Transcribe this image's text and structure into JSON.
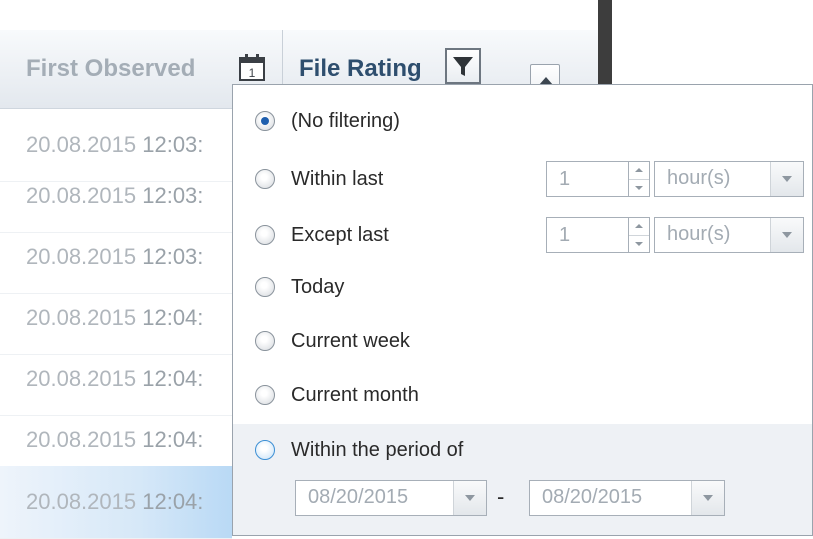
{
  "header": {
    "first_observed_label": "First Observed",
    "file_rating_label": "File Rating"
  },
  "rows": [
    {
      "date": "20.08.2015",
      "time": "12:03:"
    },
    {
      "date": "20.08.2015",
      "time": "12:03:"
    },
    {
      "date": "20.08.2015",
      "time": "12:03:"
    },
    {
      "date": "20.08.2015",
      "time": "12:04:"
    },
    {
      "date": "20.08.2015",
      "time": "12:04:"
    },
    {
      "date": "20.08.2015",
      "time": "12:04:"
    },
    {
      "date": "20.08.2015",
      "time": "12:04:"
    }
  ],
  "filter": {
    "options": [
      {
        "label": "(No filtering)",
        "checked": true
      },
      {
        "label": "Within last",
        "checked": false
      },
      {
        "label": "Except last",
        "checked": false
      },
      {
        "label": "Today",
        "checked": false
      },
      {
        "label": "Current week",
        "checked": false
      },
      {
        "label": "Current month",
        "checked": false
      },
      {
        "label": "Within the period of",
        "checked": false
      }
    ],
    "within_last": {
      "value": "1",
      "unit": "hour(s)"
    },
    "except_last": {
      "value": "1",
      "unit": "hour(s)"
    },
    "period": {
      "from": "08/20/2015",
      "separator": "-",
      "to": "08/20/2015"
    }
  }
}
